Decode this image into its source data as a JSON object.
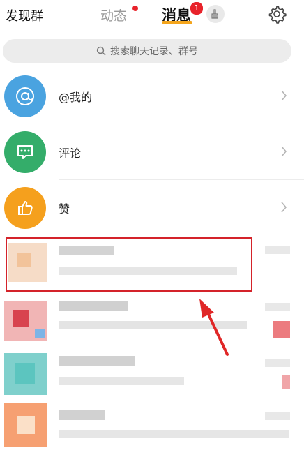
{
  "header": {
    "discover_label": "发现群",
    "tabs": [
      {
        "label": "动态"
      },
      {
        "label": "消息",
        "badge": "1"
      }
    ]
  },
  "search": {
    "placeholder": "搜索聊天记录、群号"
  },
  "rows": [
    {
      "label": "@我的",
      "color": "#4aa3e0",
      "icon": "at-icon"
    },
    {
      "label": "评论",
      "color": "#34ad6a",
      "icon": "comment-icon"
    },
    {
      "label": "赞",
      "color": "#f5a01d",
      "icon": "thumbs-up-icon"
    }
  ],
  "colors": {
    "accent": "#f4a51c",
    "badge": "#e8232b",
    "highlight": "#d4232a"
  }
}
